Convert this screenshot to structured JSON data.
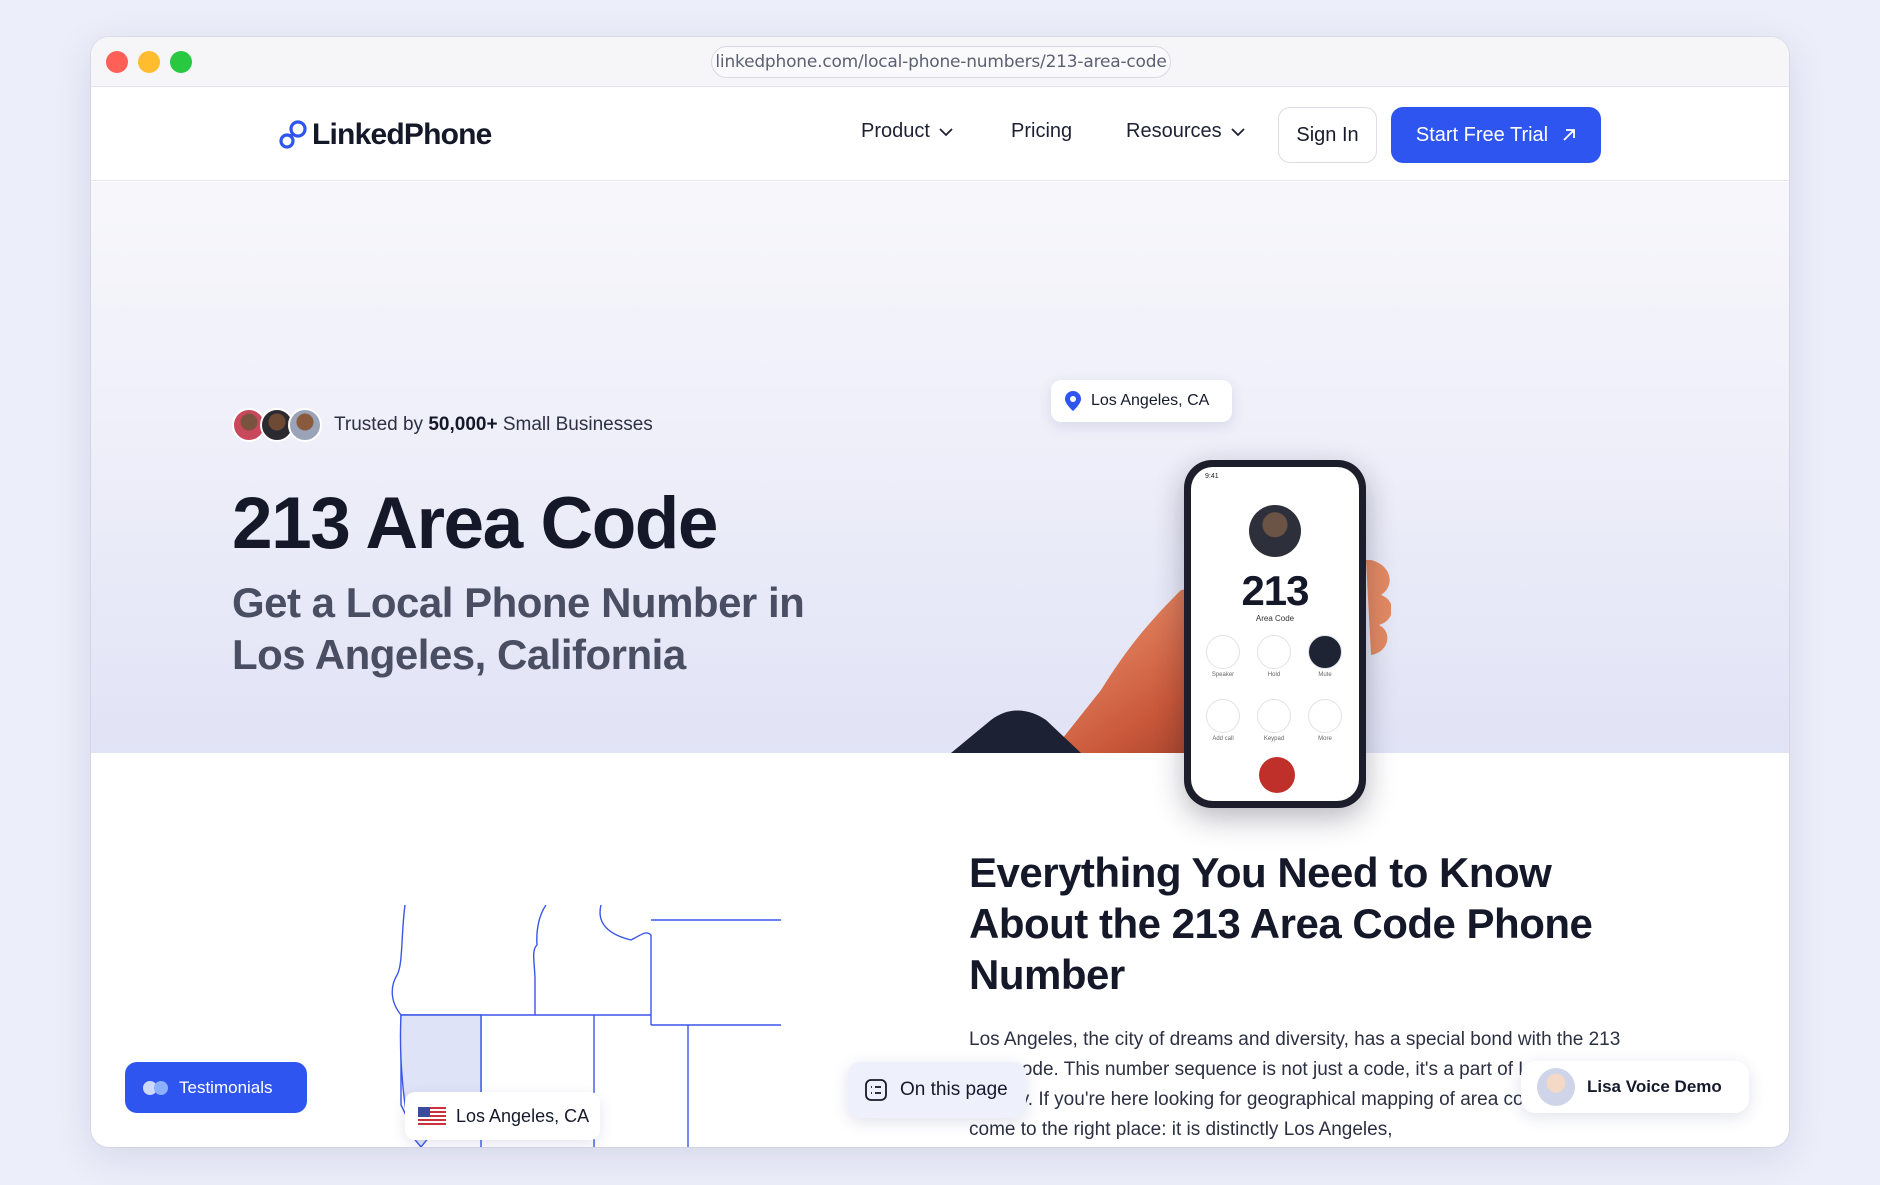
{
  "browser": {
    "url": "linkedphone.com/local-phone-numbers/213-area-code"
  },
  "nav": {
    "logo_text": "LinkedPhone",
    "items": [
      {
        "label": "Product",
        "has_dropdown": true
      },
      {
        "label": "Pricing",
        "has_dropdown": false
      },
      {
        "label": "Resources",
        "has_dropdown": true
      }
    ],
    "sign_in": "Sign In",
    "start_trial": "Start Free Trial"
  },
  "hero": {
    "trusted_prefix": "Trusted by",
    "trusted_count": "50,000+",
    "trusted_suffix": "Small Businesses",
    "title": "213 Area Code",
    "subtitle": "Get a Local Phone Number in Los Angeles, California",
    "location_chip": "Los Angeles, CA",
    "phone": {
      "time": "9:41",
      "number": "213",
      "number_caption": "Area Code",
      "buttons": [
        "Speaker",
        "Hold",
        "Mute",
        "Add call",
        "Keypad",
        "More"
      ]
    }
  },
  "map": {
    "location_chip": "Los Angeles, CA"
  },
  "section": {
    "title": "Everything You Need to Know About the 213 Area Code Phone Number",
    "body": "Los Angeles, the city of dreams and diversity, has a special bond with the 213 area code. This number sequence is not just a code, it's a part of Los Angeles' identity. If you're here looking for geographical mapping of area code 213, you've come to the right place: it is distinctly Los Angeles,"
  },
  "floating": {
    "testimonials": "Testimonials",
    "on_this_page": "On this page",
    "voice_demo": "Lisa Voice Demo"
  },
  "colors": {
    "accent": "#2f55f0",
    "heading": "#141828",
    "map_line": "#3a57e8",
    "map_fill": "#dfe3f7"
  }
}
